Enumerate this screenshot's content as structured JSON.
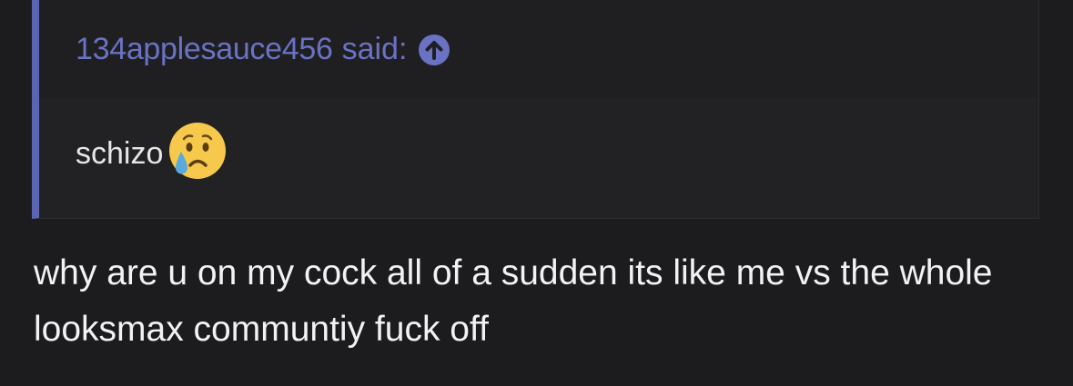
{
  "quote": {
    "author": "134applesauce456",
    "said_label": "said:",
    "jump_icon": "arrow-up-circle-icon",
    "text": "schizo",
    "emoji": "crying-face-icon"
  },
  "reply": {
    "text": "why are u on my cock all of a sudden its like me vs the whole looksmax communtiy fuck off"
  },
  "colors": {
    "background": "#1c1c1e",
    "quote_background": "#222224",
    "quote_accent": "#5c64b4",
    "author_color": "#6a72c4",
    "text_color": "#f2f2f4"
  }
}
